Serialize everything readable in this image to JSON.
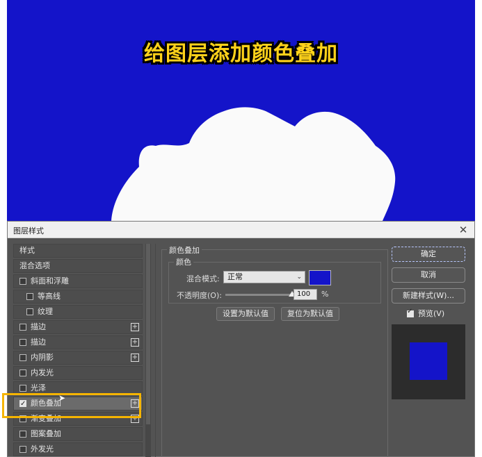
{
  "headline": "给图层添加颜色叠加",
  "colors": {
    "canvas": "#1414c9",
    "headline": "#ffd21a",
    "highlight": "#f5b400",
    "overlay_color": "#1414c9"
  },
  "dialog": {
    "title": "图层样式",
    "close_icon": "close-icon"
  },
  "style_list": {
    "header": "样式",
    "blend_options": "混合选项",
    "items": [
      {
        "label": "斜面和浮雕",
        "checked": false
      },
      {
        "label": "等高线",
        "checked": false
      },
      {
        "label": "纹理",
        "checked": false
      },
      {
        "label": "描边",
        "checked": false,
        "add": "+"
      },
      {
        "label": "描边",
        "checked": false,
        "add": "+"
      },
      {
        "label": "内阴影",
        "checked": false,
        "add": "+"
      },
      {
        "label": "内发光",
        "checked": false
      },
      {
        "label": "光泽",
        "checked": false
      },
      {
        "label": "颜色叠加",
        "checked": true,
        "add": "+"
      },
      {
        "label": "渐变叠加",
        "checked": false,
        "add": "+"
      },
      {
        "label": "图案叠加",
        "checked": false
      },
      {
        "label": "外发光",
        "checked": false
      }
    ]
  },
  "panel": {
    "group_title": "颜色叠加",
    "sub_group_title": "颜色",
    "blend_mode_label": "混合模式:",
    "blend_mode_value": "正常",
    "opacity_label": "不透明度(O):",
    "opacity_value": "100",
    "opacity_unit": "%",
    "opacity_level": 1.0,
    "set_default": "设置为默认值",
    "reset_default": "复位为默认值"
  },
  "actions": {
    "ok": "确定",
    "cancel": "取消",
    "new_style": "新建样式(W)...",
    "preview": "预览(V)",
    "preview_checked": true
  }
}
